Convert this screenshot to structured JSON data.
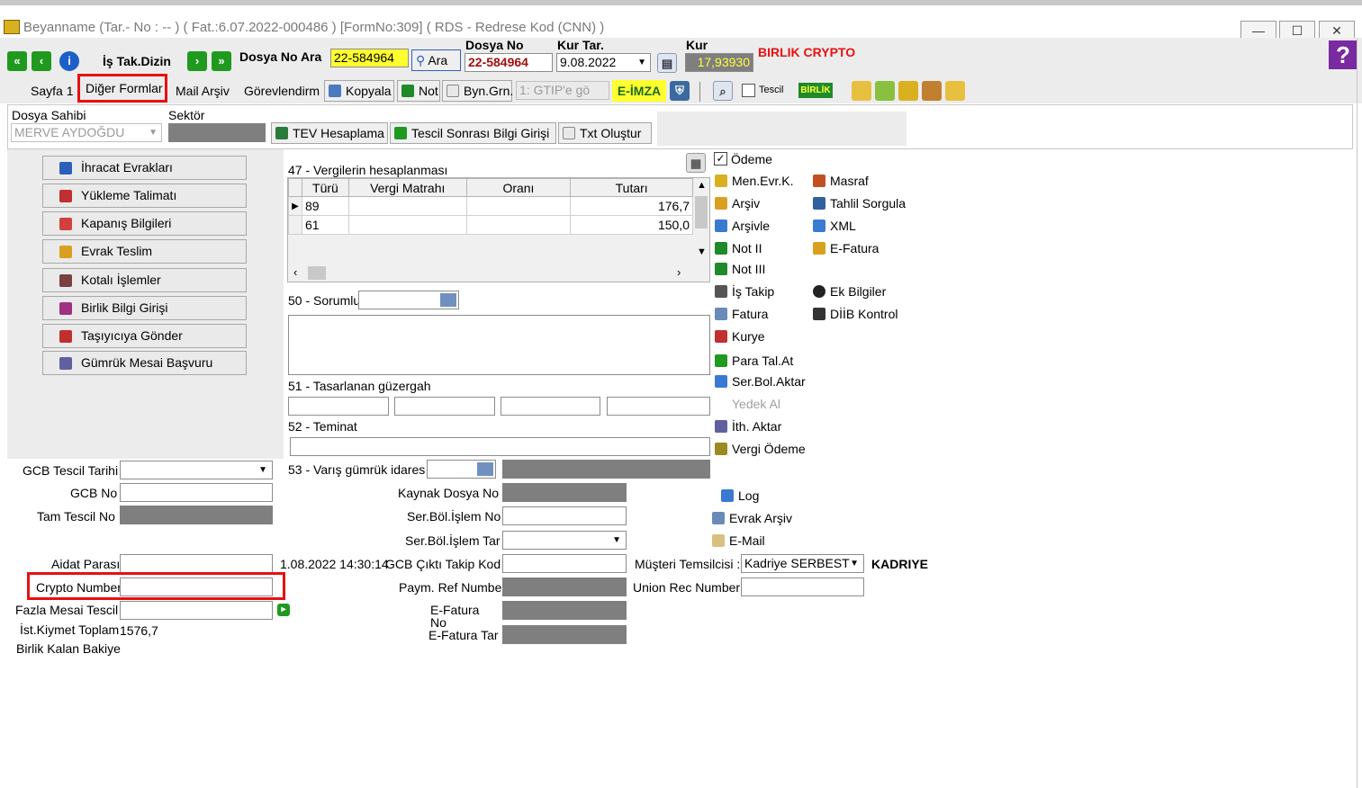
{
  "window": {
    "title": "Beyanname (Tar.- No :  --  ) ( Fat.:6.07.2022-000486 )  [FormNo:309]  ( RDS - Redrese Kod (CNN) )",
    "min": "—",
    "max": "☐",
    "close": "✕"
  },
  "toolbar": {
    "is_tak_dizin": "İş Tak.Dizin",
    "dosya_no_ara_label": "Dosya No Ara",
    "dosya_no_ara_value": "22-584964",
    "ara_button": "Ara",
    "dosya_no_label": "Dosya No",
    "dosya_no_value": "22-584964",
    "kur_tar_label": "Kur Tar.",
    "kur_tar_value": "9.08.2022",
    "kur_label": "Kur",
    "kur_value": "17,93930",
    "birlik_crypto": "BIRLIK CRYPTO",
    "help": "?"
  },
  "tabs": {
    "sayfa1": "Sayfa 1",
    "diger_formlar": "Diğer Formlar",
    "mail_arsiv": "Mail Arşiv",
    "gorevlendirm": "Görevlendirm",
    "kopyala": "Kopyala",
    "not": "Not",
    "byn_grn": "Byn.Grn.",
    "gtip_placeholder": "1: GTIP'e gö",
    "e_imza": "E-İMZA",
    "tescil": "Tescil",
    "birlik": "BİRLİK"
  },
  "top_panel": {
    "dosya_sahibi_label": "Dosya Sahibi",
    "dosya_sahibi_value": "MERVE AYDOĞDU",
    "sektor_label": "Sektör",
    "tev_hesaplama": "TEV Hesaplama",
    "tescil_sonrasi": "Tescil Sonrası Bilgi Girişi",
    "txt_olustur": "Txt Oluştur"
  },
  "left_menu": [
    {
      "label": "İhracat Evrakları",
      "color": "#2b5fb8"
    },
    {
      "label": "Yükleme Talimatı",
      "color": "#c03030"
    },
    {
      "label": "Kapanış Bilgileri",
      "color": "#d04040"
    },
    {
      "label": "Evrak Teslim",
      "color": "#d9a020"
    },
    {
      "label": "Kotalı İşlemler",
      "color": "#7a4040"
    },
    {
      "label": "Birlik Bilgi Girişi",
      "color": "#a03080"
    },
    {
      "label": "Taşıyıcıya Gönder",
      "color": "#c03030"
    },
    {
      "label": "Gümrük Mesai Başvuru",
      "color": "#6060a0"
    }
  ],
  "tax_grid": {
    "title": "47 - Vergilerin hesaplanması",
    "columns": [
      "Türü",
      "Vergi Matrahı",
      "Oranı",
      "Tutarı"
    ],
    "rows": [
      {
        "turu": "89",
        "matrah": "",
        "oran": "",
        "tutar": "176,7"
      },
      {
        "turu": "61",
        "matrah": "",
        "oran": "",
        "tutar": "150,0"
      }
    ]
  },
  "fields": {
    "sorumlu": "50 - Sorumlu",
    "tasarlanan": "51 - Tasarlanan güzergah",
    "teminat": "52 - Teminat",
    "varis": "53 - Varış gümrük idares",
    "gcb_tescil_tarihi": "GCB Tescil Tarihi",
    "gcb_no": "GCB No",
    "tam_tescil_no": "Tam Tescil No",
    "aidat_parasi": "Aidat Parası",
    "crypto_number": "Crypto Number",
    "fazla_mesai": "Fazla Mesai Tescil",
    "ist_kiymet_label": "İst.Kiymet Toplam",
    "ist_kiymet_value": "1576,7",
    "birlik_kalan": "Birlik Kalan Bakiye",
    "timestamp": "1.08.2022 14:30:14",
    "kaynak_dosya_no": "Kaynak Dosya No",
    "ser_bol_islem_no": "Ser.Böl.İşlem No",
    "ser_bol_islem_tar": "Ser.Böl.İşlem Tar",
    "gcb_cikti": "GCB Çıktı Takip Kod",
    "paym_ref": "Paym. Ref Number",
    "e_fatura_no": "E-Fatura No",
    "e_fatura_tar": "E-Fatura Tar",
    "musteri_temsilcisi": "Müşteri Temsilcisi :",
    "musteri_value": "Kadriye SERBEST",
    "kadriye": "KADRIYE",
    "union_rec": "Union Rec Number"
  },
  "right_links": {
    "odeme": "Ödeme",
    "col1": [
      {
        "label": "Men.Evr.K.",
        "color": "#d9b020"
      },
      {
        "label": "Arşiv",
        "color": "#d9a020"
      },
      {
        "label": "Arşivle",
        "color": "#3a7ad0"
      },
      {
        "label": "Not II",
        "color": "#1e8a2a"
      },
      {
        "label": "Not III",
        "color": "#1e8a2a"
      },
      {
        "label": "İş Takip",
        "color": "#555555"
      },
      {
        "label": "Fatura",
        "color": "#6a8ab8"
      },
      {
        "label": "Kurye",
        "color": "#c03030"
      },
      {
        "label": "Para Tal.At",
        "color": "#1f9a1f"
      },
      {
        "label": "Ser.Bol.Aktar",
        "color": "#3a7ad0"
      },
      {
        "label": "Yedek Al",
        "color": "#bbbbbb"
      },
      {
        "label": "İth. Aktar",
        "color": "#6060a0"
      },
      {
        "label": "Vergi Ödeme",
        "color": "#9a8a20"
      }
    ],
    "col2": [
      {
        "label": "Masraf",
        "color": "#c05020"
      },
      {
        "label": "Tahlil Sorgula",
        "color": "#3060a0"
      },
      {
        "label": "XML",
        "color": "#3a7ad0"
      },
      {
        "label": "E-Fatura",
        "color": "#d9a020"
      },
      {
        "label": "Ek Bilgiler",
        "color": "#222222"
      },
      {
        "label": "DİİB Kontrol",
        "color": "#333333"
      }
    ],
    "log": "Log",
    "evrak_arsiv": "Evrak Arşiv",
    "email": "E-Mail"
  }
}
